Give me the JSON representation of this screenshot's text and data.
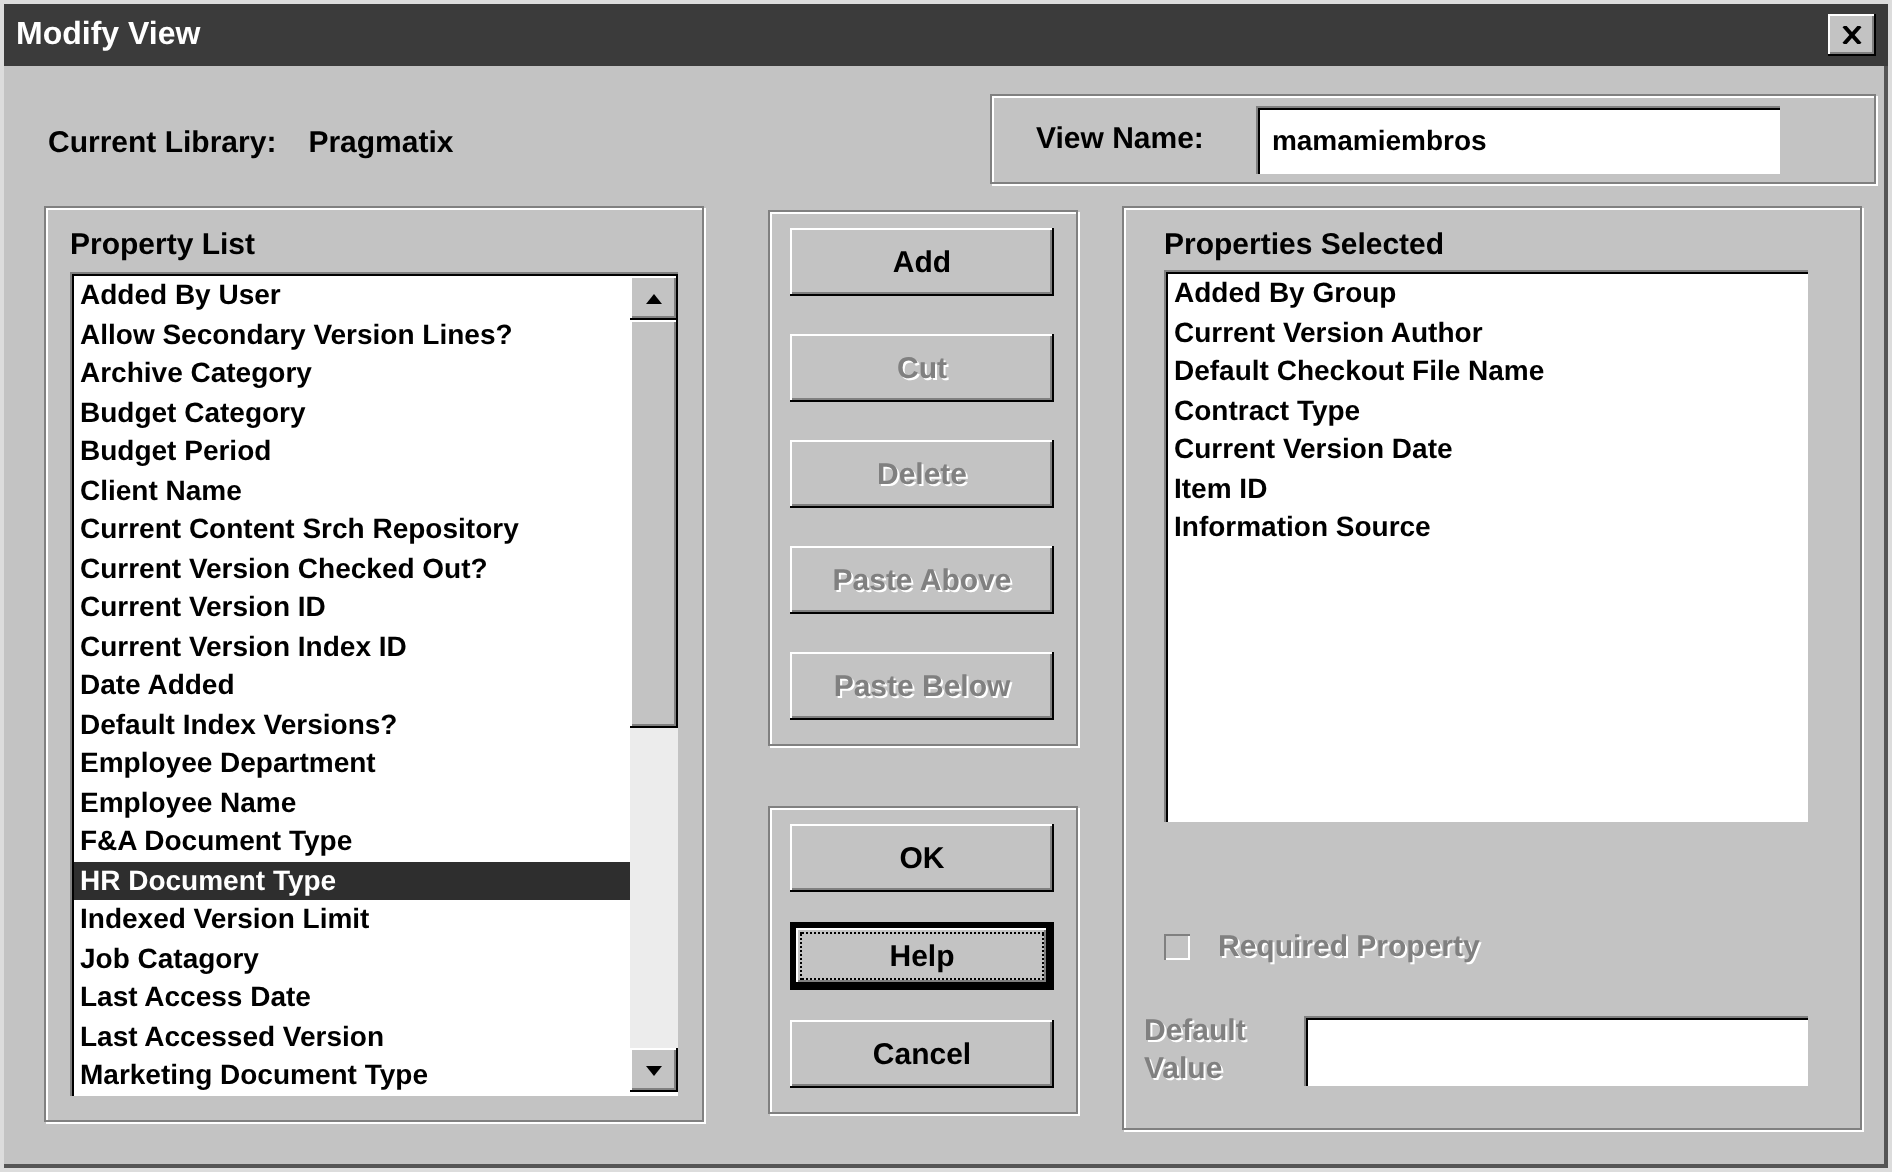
{
  "window": {
    "title": "Modify View"
  },
  "current_library": {
    "label": "Current Library:",
    "value": "Pragmatix"
  },
  "view_name": {
    "label": "View Name:",
    "value": "mamamiembros"
  },
  "property_list": {
    "title": "Property List",
    "items": [
      {
        "label": "Added By User",
        "selected": false
      },
      {
        "label": "Allow Secondary Version Lines?",
        "selected": false
      },
      {
        "label": "Archive Category",
        "selected": false
      },
      {
        "label": "Budget Category",
        "selected": false
      },
      {
        "label": "Budget Period",
        "selected": false
      },
      {
        "label": "Client Name",
        "selected": false
      },
      {
        "label": "Current Content Srch Repository",
        "selected": false
      },
      {
        "label": "Current Version Checked Out?",
        "selected": false
      },
      {
        "label": "Current Version ID",
        "selected": false
      },
      {
        "label": "Current Version Index ID",
        "selected": false
      },
      {
        "label": "Date Added",
        "selected": false
      },
      {
        "label": "Default Index Versions?",
        "selected": false
      },
      {
        "label": "Employee Department",
        "selected": false
      },
      {
        "label": "Employee Name",
        "selected": false
      },
      {
        "label": "F&A Document Type",
        "selected": false
      },
      {
        "label": "HR Document Type",
        "selected": true
      },
      {
        "label": "Indexed Version Limit",
        "selected": false
      },
      {
        "label": "Job Catagory",
        "selected": false
      },
      {
        "label": "Last Access Date",
        "selected": false
      },
      {
        "label": "Last Accessed Version",
        "selected": false
      },
      {
        "label": "Marketing Document Type",
        "selected": false
      }
    ]
  },
  "edit_buttons": [
    {
      "label": "Add",
      "disabled": false
    },
    {
      "label": "Cut",
      "disabled": true
    },
    {
      "label": "Delete",
      "disabled": true
    },
    {
      "label": "Paste Above",
      "disabled": true
    },
    {
      "label": "Paste Below",
      "disabled": true
    }
  ],
  "dialog_buttons": [
    {
      "label": "OK",
      "focused": false
    },
    {
      "label": "Help",
      "focused": true
    },
    {
      "label": "Cancel",
      "focused": false
    }
  ],
  "properties_selected": {
    "title": "Properties Selected",
    "items": [
      "Added By Group",
      "Current Version Author",
      "Default Checkout File Name",
      "Contract Type",
      "Current Version Date",
      "Item ID",
      "Information Source"
    ]
  },
  "required_property": {
    "label": "Required Property",
    "checked": false,
    "disabled": true
  },
  "default_value": {
    "label": "Default Value",
    "disabled": true
  }
}
